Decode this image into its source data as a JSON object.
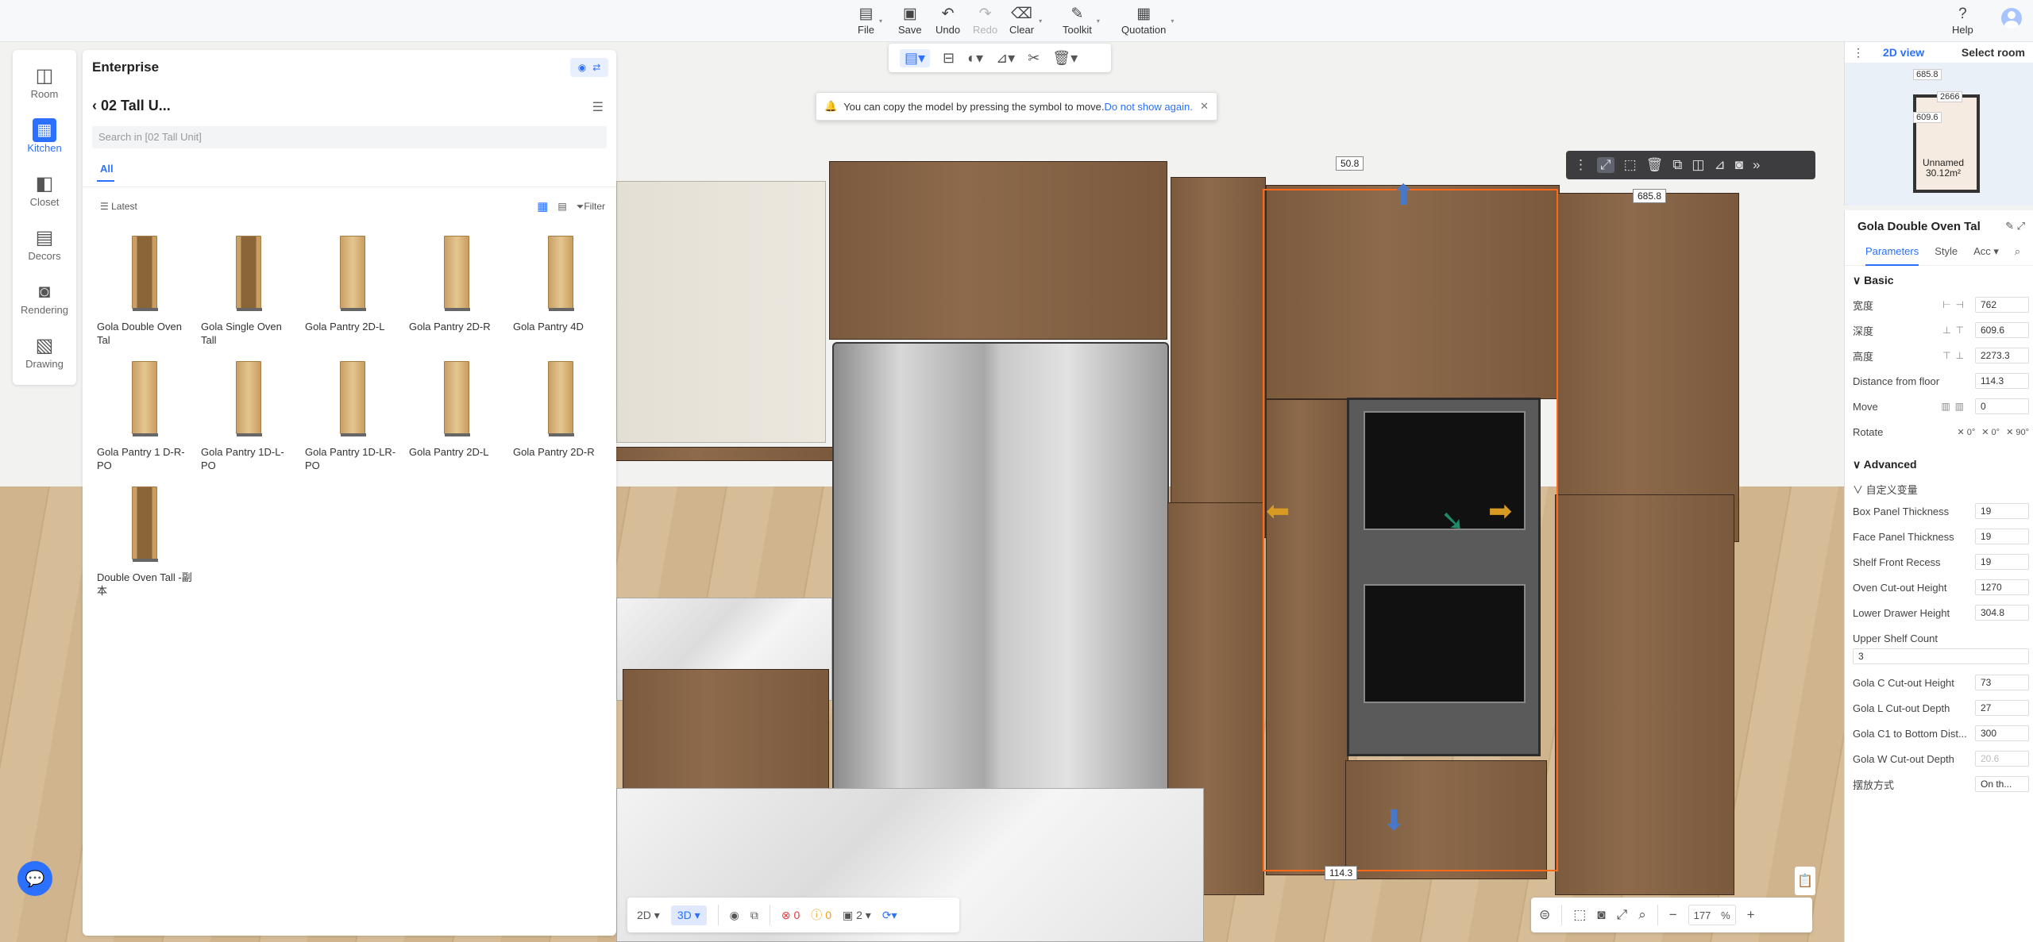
{
  "toolbar": {
    "items": [
      {
        "label": "File",
        "icon": "file-icon"
      },
      {
        "label": "Save",
        "icon": "save-icon"
      },
      {
        "label": "Undo",
        "icon": "undo-icon"
      },
      {
        "label": "Redo",
        "icon": "redo-icon"
      },
      {
        "label": "Clear",
        "icon": "eraser-icon"
      },
      {
        "label": "Toolkit",
        "icon": "wrench-icon"
      },
      {
        "label": "Quotation",
        "icon": "quotation-icon"
      }
    ],
    "help": "Help"
  },
  "left_nav": [
    {
      "label": "Room",
      "icon": "room-icon"
    },
    {
      "label": "Kitchen",
      "icon": "kitchen-icon",
      "active": true
    },
    {
      "label": "Closet",
      "icon": "closet-icon"
    },
    {
      "label": "Decors",
      "icon": "decors-icon"
    },
    {
      "label": "Rendering",
      "icon": "camera-icon"
    },
    {
      "label": "Drawing",
      "icon": "drawing-icon"
    }
  ],
  "catalog": {
    "title": "Enterprise",
    "folder": "02 Tall U...",
    "search_placeholder": "Search in [02 Tall Unit]",
    "tab": "All",
    "sort": "Latest",
    "filter": "Filter",
    "items": [
      {
        "name": "Gola Double Oven Tal"
      },
      {
        "name": "Gola Single Oven Tall"
      },
      {
        "name": "Gola Pantry 2D-L"
      },
      {
        "name": "Gola Pantry 2D-R"
      },
      {
        "name": "Gola Pantry 4D"
      },
      {
        "name": "Gola Pantry 1 D-R-PO"
      },
      {
        "name": "Gola Pantry 1D-L-PO"
      },
      {
        "name": "Gola Pantry 1D-LR-PO"
      },
      {
        "name": "Gola Pantry 2D-L"
      },
      {
        "name": "Gola Pantry 2D-R"
      },
      {
        "name": "Double Oven Tall -副本"
      }
    ]
  },
  "toast": {
    "text": "You can copy the model by pressing the symbol to move.",
    "link": "Do not show again."
  },
  "dimensions": {
    "top": "50.8",
    "depth": "685.8",
    "bottom": "114.3"
  },
  "bottom_bar": {
    "view2d": "2D",
    "view3d": "3D",
    "errors": "0",
    "warnings": "0",
    "count": "2"
  },
  "zoom": {
    "value": "177",
    "unit": "%"
  },
  "minimap": {
    "tab": "2D view",
    "select_room": "Select room",
    "labels": [
      "685.8",
      "2666",
      "609.6"
    ],
    "room_name": "Unnamed",
    "room_area": "30.12m²"
  },
  "properties": {
    "title": "Gola Double Oven Tal",
    "tabs": [
      "Parameters",
      "Style",
      "Acc"
    ],
    "basic_title": "Basic",
    "basic": [
      {
        "label": "宽度",
        "value": "762"
      },
      {
        "label": "深度",
        "value": "609.6"
      },
      {
        "label": "高度",
        "value": "2273.3"
      },
      {
        "label": "Distance from floor",
        "value": "114.3"
      },
      {
        "label": "Move",
        "value": "0"
      }
    ],
    "rotate": {
      "label": "Rotate",
      "x": "0°",
      "y": "0°",
      "z": "90°"
    },
    "advanced_title": "Advanced",
    "group": "自定义变量",
    "advanced": [
      {
        "label": "Box Panel Thickness",
        "value": "19"
      },
      {
        "label": "Face Panel Thickness",
        "value": "19"
      },
      {
        "label": "Shelf Front Recess",
        "value": "19"
      },
      {
        "label": "Oven Cut-out Height",
        "value": "1270"
      },
      {
        "label": "Lower Drawer Height",
        "value": "304.8"
      }
    ],
    "shelf_count_label": "Upper Shelf Count",
    "shelf_count": "3",
    "advanced2": [
      {
        "label": "Gola C Cut-out Height",
        "value": "73"
      },
      {
        "label": "Gola L Cut-out Depth",
        "value": "27"
      },
      {
        "label": "Gola C1 to Bottom Dist...",
        "value": "300"
      },
      {
        "label": "Gola W Cut-out Depth",
        "value": "20.6"
      },
      {
        "label": "摆放方式",
        "value": "On th..."
      }
    ]
  }
}
